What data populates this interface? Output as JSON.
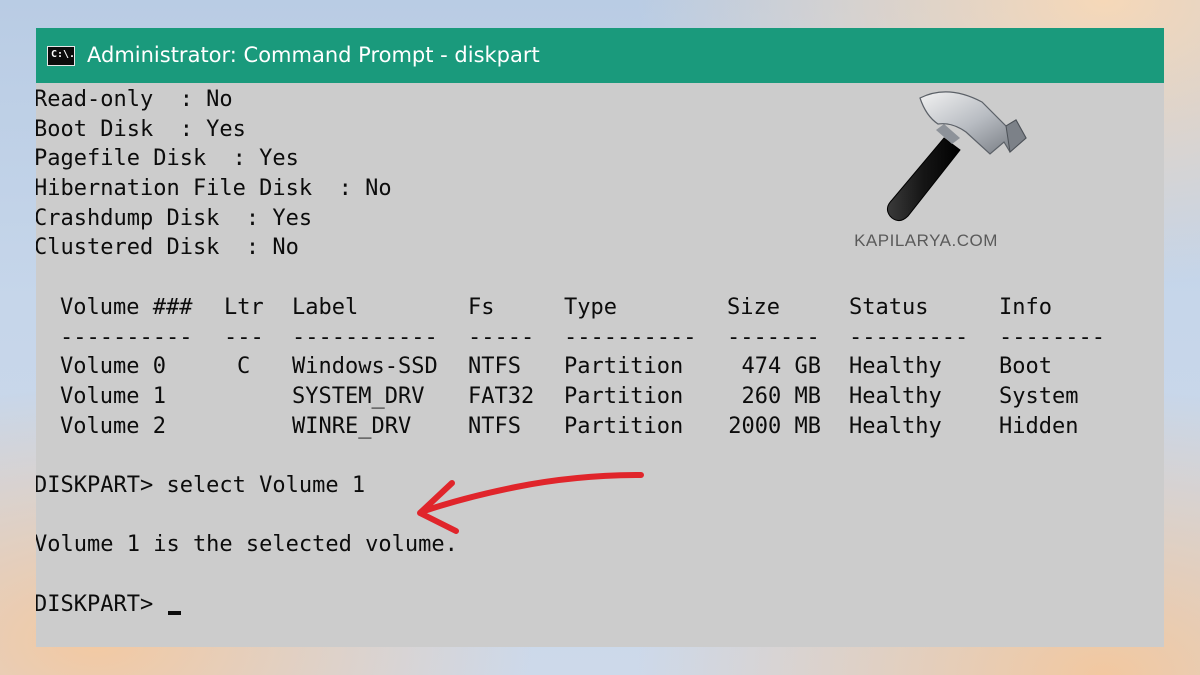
{
  "window": {
    "title": "Administrator: Command Prompt - diskpart",
    "icon_label": "C:\\."
  },
  "console": {
    "properties": [
      "Read-only  : No",
      "Boot Disk  : Yes",
      "Pagefile Disk  : Yes",
      "Hibernation File Disk  : No",
      "Crashdump Disk  : Yes",
      "Clustered Disk  : No"
    ],
    "table": {
      "headers": [
        "Volume ###",
        "Ltr",
        "Label",
        "Fs",
        "Type",
        "Size",
        "Status",
        "Info"
      ],
      "separators": [
        "----------",
        "---",
        "-----------",
        "-----",
        "----------",
        "-------",
        "---------",
        "--------"
      ],
      "rows": [
        [
          "Volume 0",
          "C",
          "Windows-SSD",
          "NTFS",
          "Partition",
          "474 GB",
          "Healthy",
          "Boot"
        ],
        [
          "Volume 1",
          "",
          "SYSTEM_DRV",
          "FAT32",
          "Partition",
          "260 MB",
          "Healthy",
          "System"
        ],
        [
          "Volume 2",
          "",
          "WINRE_DRV",
          "NTFS",
          "Partition",
          "2000 MB",
          "Healthy",
          "Hidden"
        ]
      ]
    },
    "command_line": "DISKPART> select Volume 1",
    "result": "Volume 1 is the selected volume.",
    "prompt": "DISKPART> "
  },
  "watermark": {
    "text": "KAPILARYA.COM",
    "icon": "hammer-icon"
  },
  "annotation": {
    "arrow_color": "#e0252b"
  },
  "colors": {
    "titlebar": "#1a9a7c",
    "console_bg": "#cccccc",
    "console_text": "#0c0c0c"
  }
}
